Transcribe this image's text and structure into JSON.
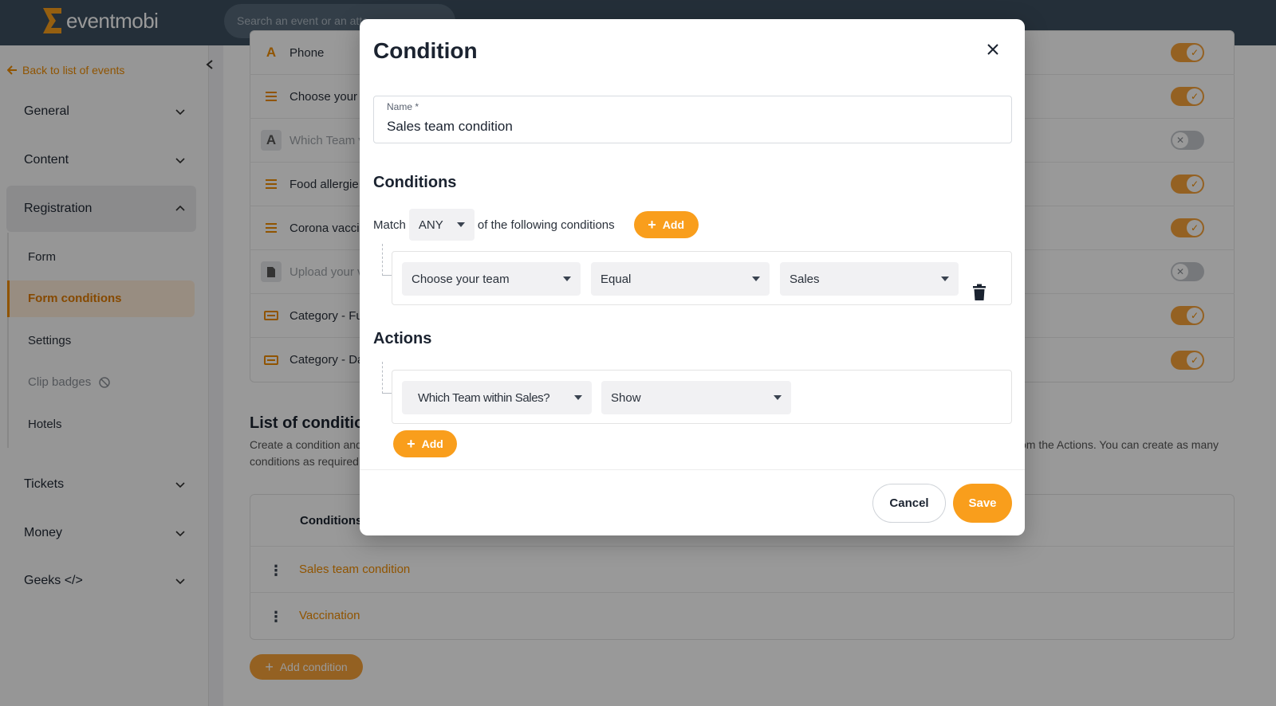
{
  "app": {
    "brand": "eventmobi",
    "search_placeholder": "Search an event or an atte"
  },
  "sidebar": {
    "back_label": "Back to list of events",
    "items": [
      {
        "label": "General"
      },
      {
        "label": "Content"
      },
      {
        "label": "Registration"
      },
      {
        "label": "Tickets"
      },
      {
        "label": "Money"
      },
      {
        "label": "Geeks </>"
      }
    ],
    "sub_items": [
      {
        "label": "Form"
      },
      {
        "label": "Form conditions"
      },
      {
        "label": "Settings"
      },
      {
        "label": "Clip badges"
      },
      {
        "label": "Hotels"
      }
    ]
  },
  "fields": [
    {
      "label": "Phone",
      "icon": "A",
      "enabled": true
    },
    {
      "label": "Choose your",
      "icon": "list",
      "enabled": true
    },
    {
      "label": "Which Team v",
      "icon": "A",
      "enabled": false
    },
    {
      "label": "Food allergie",
      "icon": "list",
      "enabled": true
    },
    {
      "label": "Corona vacci",
      "icon": "list",
      "enabled": true
    },
    {
      "label": "Upload your v",
      "icon": "file",
      "enabled": false
    },
    {
      "label": "Category - Fu",
      "icon": "ticket",
      "enabled": true
    },
    {
      "label": "Category - Da",
      "icon": "ticket",
      "enabled": true
    }
  ],
  "conditions_list": {
    "title": "List of conditions",
    "description_start": "Create a condition and",
    "description_end": "om the Actions. You can create as many",
    "description_line2": "conditions as required",
    "column_header": "Conditions",
    "rows": [
      "Sales team condition",
      "Vaccination"
    ],
    "add_label": "Add condition"
  },
  "modal": {
    "title": "Condition",
    "name_label": "Name *",
    "name_value": "Sales team condition",
    "conditions_title": "Conditions",
    "match_prefix": "Match",
    "match_value": "ANY",
    "match_suffix": "of the following conditions",
    "add_label": "Add",
    "rule": {
      "field": "Choose your team",
      "operator": "Equal",
      "value": "Sales"
    },
    "actions_title": "Actions",
    "action": {
      "field": "Which Team within Sales?",
      "effect": "Show"
    },
    "cancel_label": "Cancel",
    "save_label": "Save"
  },
  "colors": {
    "accent": "#F99E1C",
    "topbar": "#3D4F5F",
    "link": "#F08C00"
  }
}
